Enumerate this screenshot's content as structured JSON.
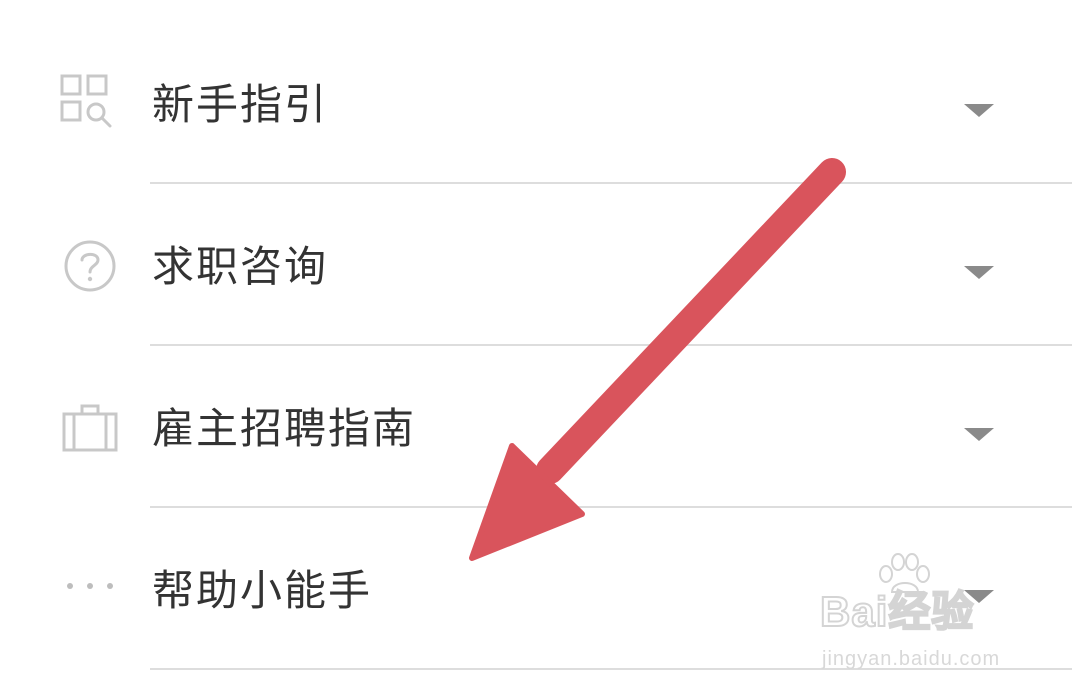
{
  "menu": {
    "items": [
      {
        "label": "新手指引",
        "icon": "grid-search-icon"
      },
      {
        "label": "求职咨询",
        "icon": "question-circle-icon"
      },
      {
        "label": "雇主招聘指南",
        "icon": "briefcase-icon"
      },
      {
        "label": "帮助小能手",
        "icon": "more-dots-icon"
      }
    ],
    "expand_icon": "caret-down-icon"
  },
  "annotation": {
    "type": "arrow",
    "color": "#d9545c",
    "points_to": "帮助小能手"
  },
  "watermark": {
    "brand": "Bai经验",
    "url": "jingyan.baidu.com"
  },
  "colors": {
    "text": "#333333",
    "icon": "#c8c8c8",
    "caret": "#8a8a8a",
    "divider": "#dddddd",
    "background": "#ffffff"
  }
}
